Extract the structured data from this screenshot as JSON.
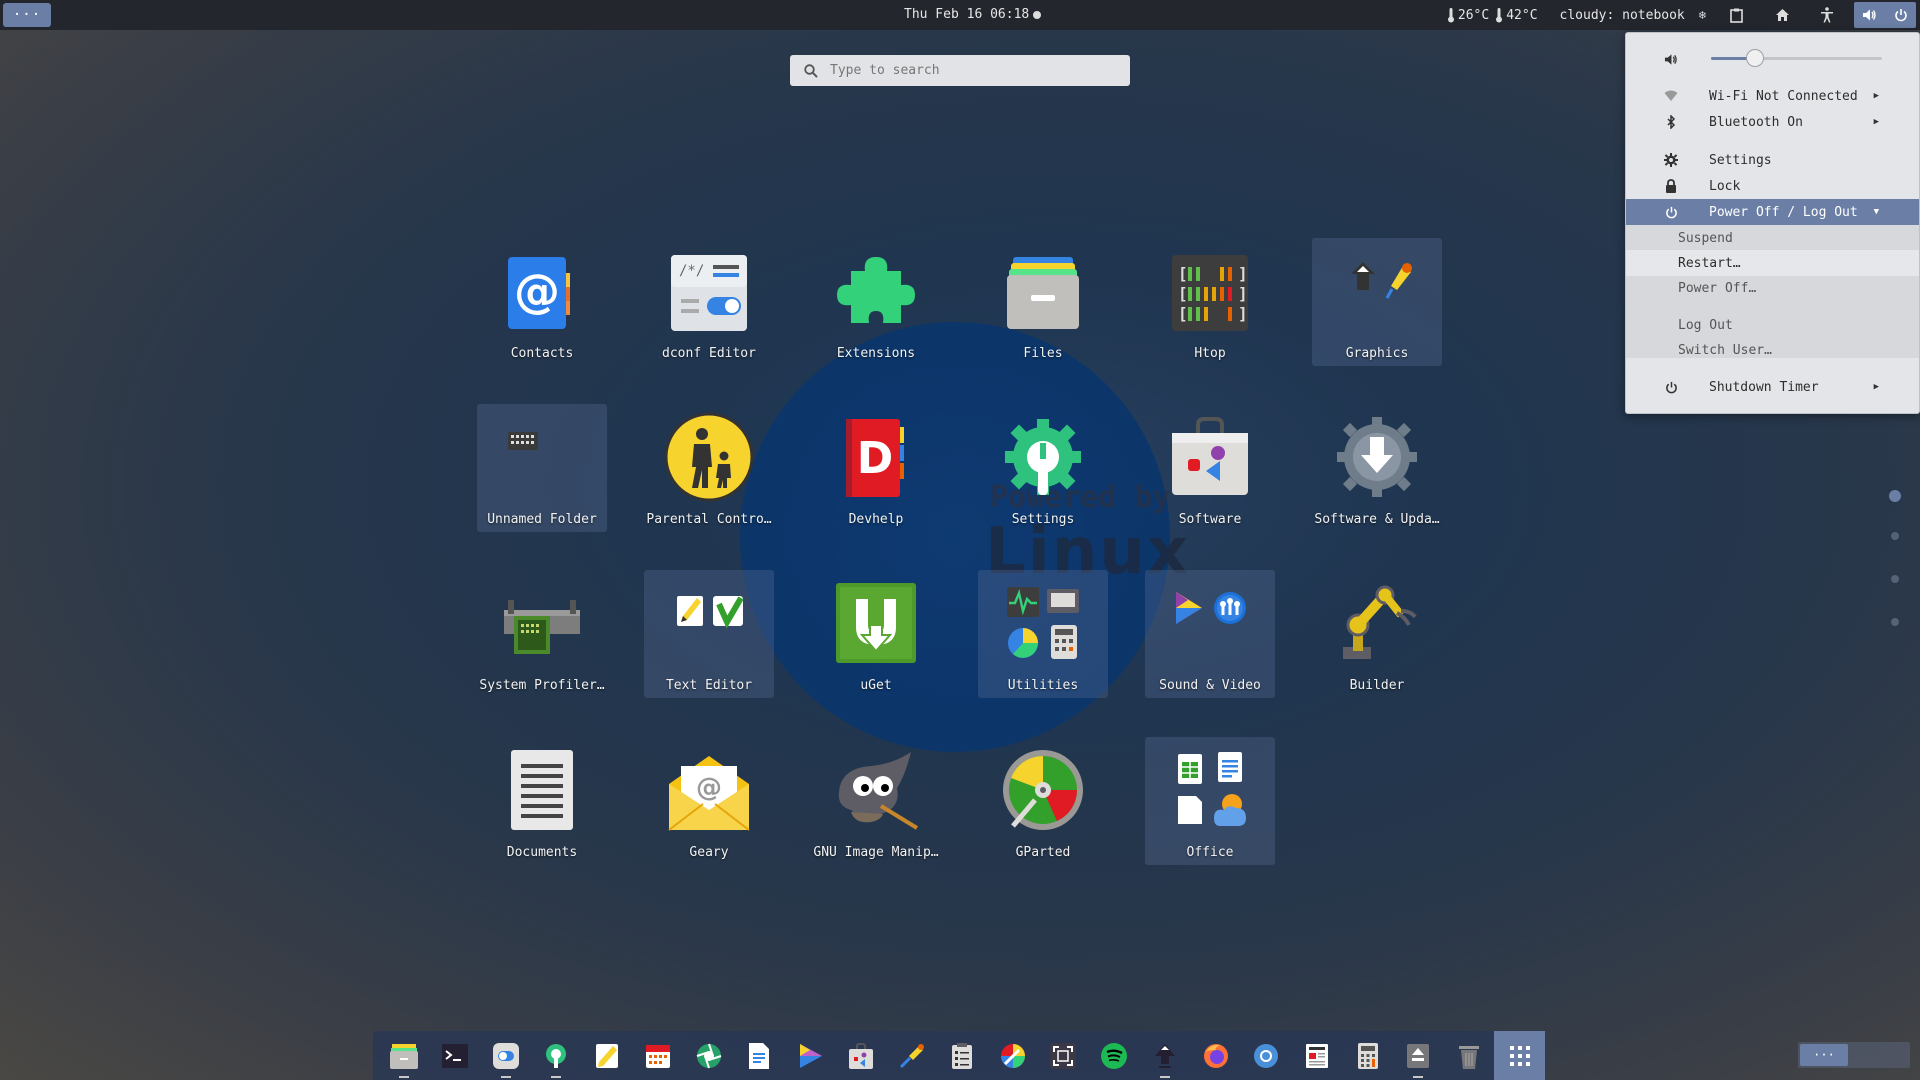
{
  "topbar": {
    "activities_label": "···",
    "clock": "Thu Feb 16 06:18",
    "temp1": "26°C",
    "temp2": "42°C",
    "weather": "cloudy: notebook"
  },
  "search": {
    "placeholder": "Type to search"
  },
  "apps": [
    {
      "label": "Contacts"
    },
    {
      "label": "dconf Editor"
    },
    {
      "label": "Extensions"
    },
    {
      "label": "Files"
    },
    {
      "label": "Htop"
    },
    {
      "label": "Graphics"
    },
    {
      "label": "Unnamed Folder"
    },
    {
      "label": "Parental Contro…"
    },
    {
      "label": "Devhelp"
    },
    {
      "label": "Settings"
    },
    {
      "label": "Software"
    },
    {
      "label": "Software & Upda…"
    },
    {
      "label": "System Profiler…"
    },
    {
      "label": "Text Editor"
    },
    {
      "label": "uGet"
    },
    {
      "label": "Utilities"
    },
    {
      "label": "Sound & Video"
    },
    {
      "label": "Builder"
    },
    {
      "label": "Documents"
    },
    {
      "label": "Geary"
    },
    {
      "label": "GNU Image Manip…"
    },
    {
      "label": "GParted"
    },
    {
      "label": "Office"
    }
  ],
  "background": {
    "line1": "Powered by",
    "line2": "Linux"
  },
  "system_menu": {
    "volume_level": 0.26,
    "wifi": "Wi-Fi Not Connected",
    "bluetooth": "Bluetooth On",
    "settings": "Settings",
    "lock": "Lock",
    "power": "Power Off / Log Out",
    "suspend": "Suspend",
    "restart": "Restart…",
    "poweroff": "Power Off…",
    "logout": "Log Out",
    "switch_user": "Switch User…",
    "shutdown_timer": "Shutdown Timer"
  },
  "dock": {
    "items": [
      "files-icon",
      "terminal-icon",
      "tweaks-icon",
      "builder-icon",
      "text-editor-icon",
      "calendar-icon",
      "aperture-icon",
      "documents-icon",
      "videos-icon",
      "software-icon",
      "color-picker-icon",
      "notes-icon",
      "color-wheel-icon",
      "screenshot-icon",
      "spotify-icon",
      "inkscape-icon",
      "firefox-icon",
      "chromium-icon",
      "newspaper-icon",
      "calculator-icon",
      "usb-writer-icon",
      "trash-icon",
      "show-apps-icon"
    ]
  },
  "mini_dash_label": "···",
  "colors": {
    "accent": "#6b7fa6",
    "topbar": "#23262d",
    "menu_bg": "#e4e5e8"
  }
}
